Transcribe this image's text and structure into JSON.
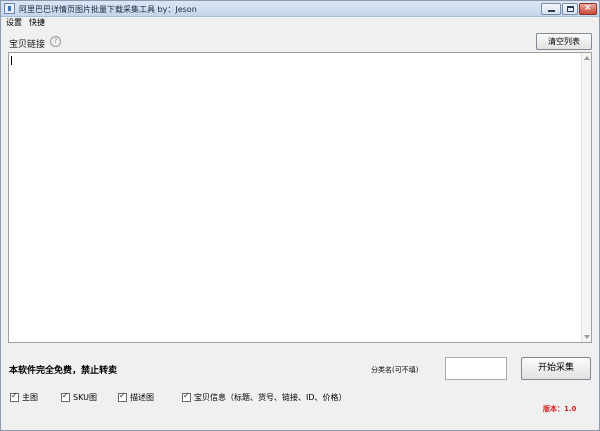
{
  "window": {
    "title": "阿里巴巴详情页图片批量下载采集工具 by：Jeson",
    "close_glyph": "×"
  },
  "menu": {
    "items": [
      "设置",
      "快捷"
    ]
  },
  "link_section": {
    "label": "宝贝链接",
    "help_glyph": "?",
    "clear_button": "清空列表",
    "textarea_value": ""
  },
  "bottom": {
    "free_note": "本软件完全免费，禁止转卖",
    "category_label": "分类名(可不填)",
    "category_value": "",
    "start_button": "开始采集",
    "checkboxes": [
      {
        "label": "主图",
        "checked": true
      },
      {
        "label": "SKU图",
        "checked": true
      },
      {
        "label": "描述图",
        "checked": true
      },
      {
        "label": "宝贝信息（标题、货号、链接、ID、价格）",
        "checked": true
      }
    ],
    "check_glyph": "✓",
    "version": "版本：1.0"
  },
  "colors": {
    "version_text": "#d61f1f",
    "title_gradient_top": "#dbe6f4"
  }
}
